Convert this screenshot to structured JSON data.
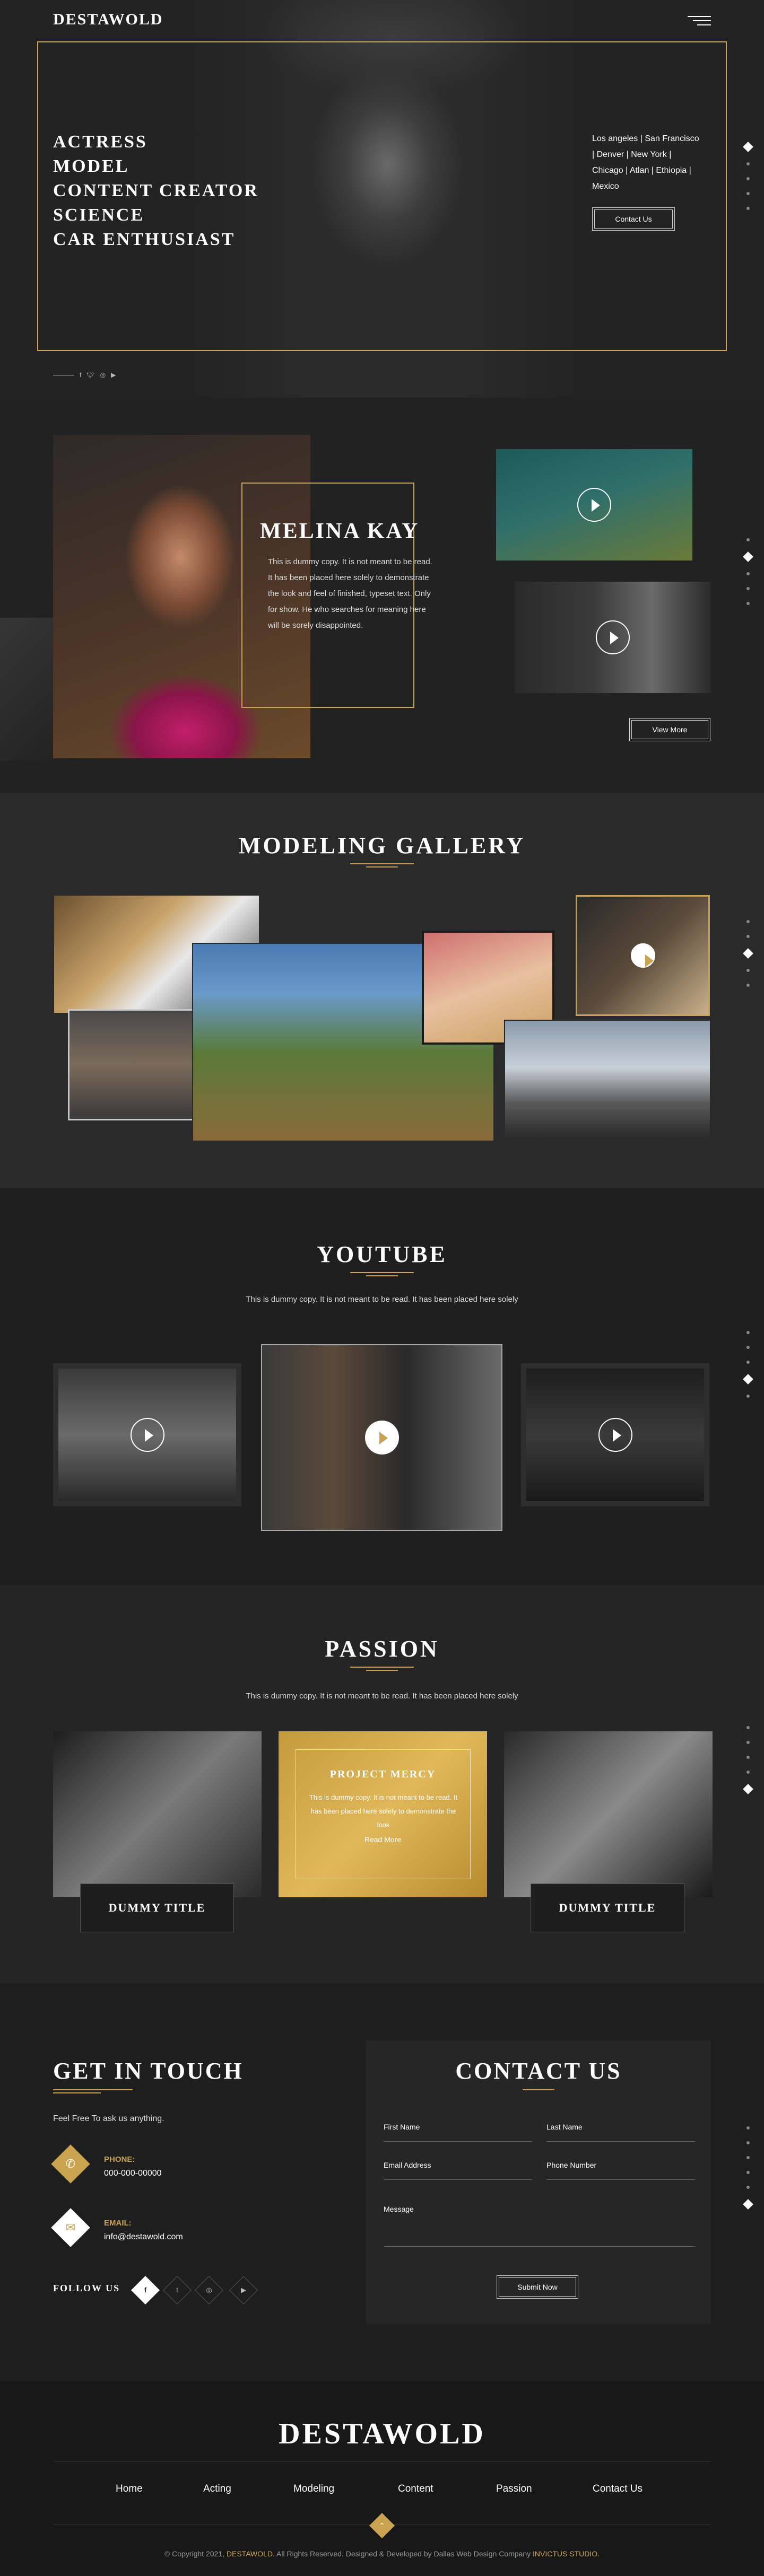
{
  "header": {
    "logo": "DESTAWOLD"
  },
  "hero": {
    "roles": [
      "ACTRESS",
      "MODEL",
      "CONTENT CREATOR",
      "SCIENCE",
      "CAR ENTHUSIAST"
    ],
    "cities": "Los angeles | San Francisco | Denver | New York | Chicago | Atlan | Ethiopia | Mexico",
    "cta": "Contact Us",
    "social_icons": [
      "facebook-icon",
      "twitter-icon",
      "instagram-icon",
      "youtube-icon"
    ]
  },
  "about": {
    "name": "MELINA KAY",
    "text": "This is dummy copy. It is not meant to be read. It has been placed here solely to demonstrate the look and feel of finished, typeset text. Only for show. He who searches for meaning here will be sorely disappointed.",
    "view_more": "View More"
  },
  "gallery": {
    "title": "MODELING GALLERY"
  },
  "youtube": {
    "title": "YOUTUBE",
    "subtitle": "This is dummy copy. It is not meant to be read. It has been placed here solely"
  },
  "passion": {
    "title": "PASSION",
    "subtitle": "This is dummy copy. It is not meant to be read. It has been placed here solely",
    "cards": [
      {
        "label": "DUMMY TITLE"
      },
      {
        "title": "PROJECT MERCY",
        "text": "This is dummy copy. It is not meant to be read. It has been placed here solely to demonstrate the look",
        "link": "Read More"
      },
      {
        "label": "DUMMY TITLE"
      }
    ]
  },
  "contact": {
    "title": "GET IN TOUCH",
    "tagline": "Feel Free To ask us anything.",
    "phone_label": "PHONE:",
    "phone": "000-000-00000",
    "email_label": "EMAIL:",
    "email": "info@destawold.com",
    "follow": "FOLLOW US",
    "form_title": "CONTACT US",
    "fields": {
      "first": "First Name",
      "last": "Last Name",
      "email": "Email Address",
      "phone": "Phone Number",
      "message": "Message"
    },
    "submit": "Submit Now"
  },
  "footer": {
    "logo": "DESTAWOLD",
    "nav": [
      "Home",
      "Acting",
      "Modeling",
      "Content",
      "Passion",
      "Contact Us"
    ],
    "copy_pre": "© Copyright 2021,",
    "copy_brand": "DESTAWOLD",
    "copy_mid": ". All Rights Reserved. Designed & Developed by Dallas Web Design Company",
    "copy_studio": "INVICTUS STUDIO."
  },
  "colors": {
    "accent": "#c9a34f",
    "background": "#1c1c1c"
  }
}
